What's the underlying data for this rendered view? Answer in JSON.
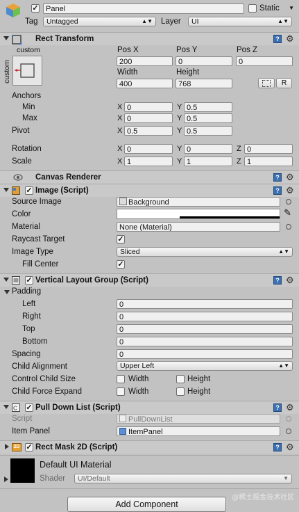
{
  "header": {
    "name": "Panel",
    "static_label": "Static",
    "tag_label": "Tag",
    "tag_value": "Untagged",
    "layer_label": "Layer",
    "layer_value": "UI"
  },
  "rect_transform": {
    "title": "Rect Transform",
    "anchor_preset_top": "custom",
    "anchor_preset_side": "custom",
    "pos_x_label": "Pos X",
    "pos_y_label": "Pos Y",
    "pos_z_label": "Pos Z",
    "pos_x": "200",
    "pos_y": "0",
    "pos_z": "0",
    "width_label": "Width",
    "height_label": "Height",
    "width": "400",
    "height": "768",
    "raw_button": "R",
    "anchors_label": "Anchors",
    "min_label": "Min",
    "max_label": "Max",
    "min_x": "0",
    "min_y": "0.5",
    "max_x": "0",
    "max_y": "0.5",
    "pivot_label": "Pivot",
    "pivot_x": "0.5",
    "pivot_y": "0.5",
    "rotation_label": "Rotation",
    "rot_x": "0",
    "rot_y": "0",
    "rot_z": "0",
    "scale_label": "Scale",
    "scale_x": "1",
    "scale_y": "1",
    "scale_z": "1",
    "axis_x": "X",
    "axis_y": "Y",
    "axis_z": "Z"
  },
  "canvas_renderer": {
    "title": "Canvas Renderer"
  },
  "image_script": {
    "title": "Image (Script)",
    "source_image_label": "Source Image",
    "source_image": "Background",
    "color_label": "Color",
    "material_label": "Material",
    "material": "None (Material)",
    "raycast_label": "Raycast Target",
    "image_type_label": "Image Type",
    "image_type": "Sliced",
    "fill_center_label": "Fill Center"
  },
  "vlg": {
    "title": "Vertical Layout Group (Script)",
    "padding_label": "Padding",
    "left_label": "Left",
    "left": "0",
    "right_label": "Right",
    "right": "0",
    "top_label": "Top",
    "top": "0",
    "bottom_label": "Bottom",
    "bottom": "0",
    "spacing_label": "Spacing",
    "spacing": "0",
    "child_alignment_label": "Child Alignment",
    "child_alignment": "Upper Left",
    "control_child_size_label": "Control Child Size",
    "child_force_expand_label": "Child Force Expand",
    "width_label": "Width",
    "height_label": "Height"
  },
  "pull_down": {
    "title": "Pull Down List (Script)",
    "script_label": "Script",
    "script": "PullDownList",
    "item_panel_label": "Item Panel",
    "item_panel": "ItemPanel"
  },
  "rect_mask": {
    "title": "Rect Mask 2D (Script)",
    "badge": "2D"
  },
  "material_preview": {
    "name": "Default UI Material",
    "shader_label": "Shader",
    "shader": "UI/Default"
  },
  "add_component": "Add Component",
  "watermark": "@稀土掘金技术社区",
  "colors": {
    "panel_bg": "#c2c2c2",
    "header_bg": "#c9c9c9",
    "field_bg": "#f0f0f0",
    "book_icon": "#3b6fb0"
  }
}
